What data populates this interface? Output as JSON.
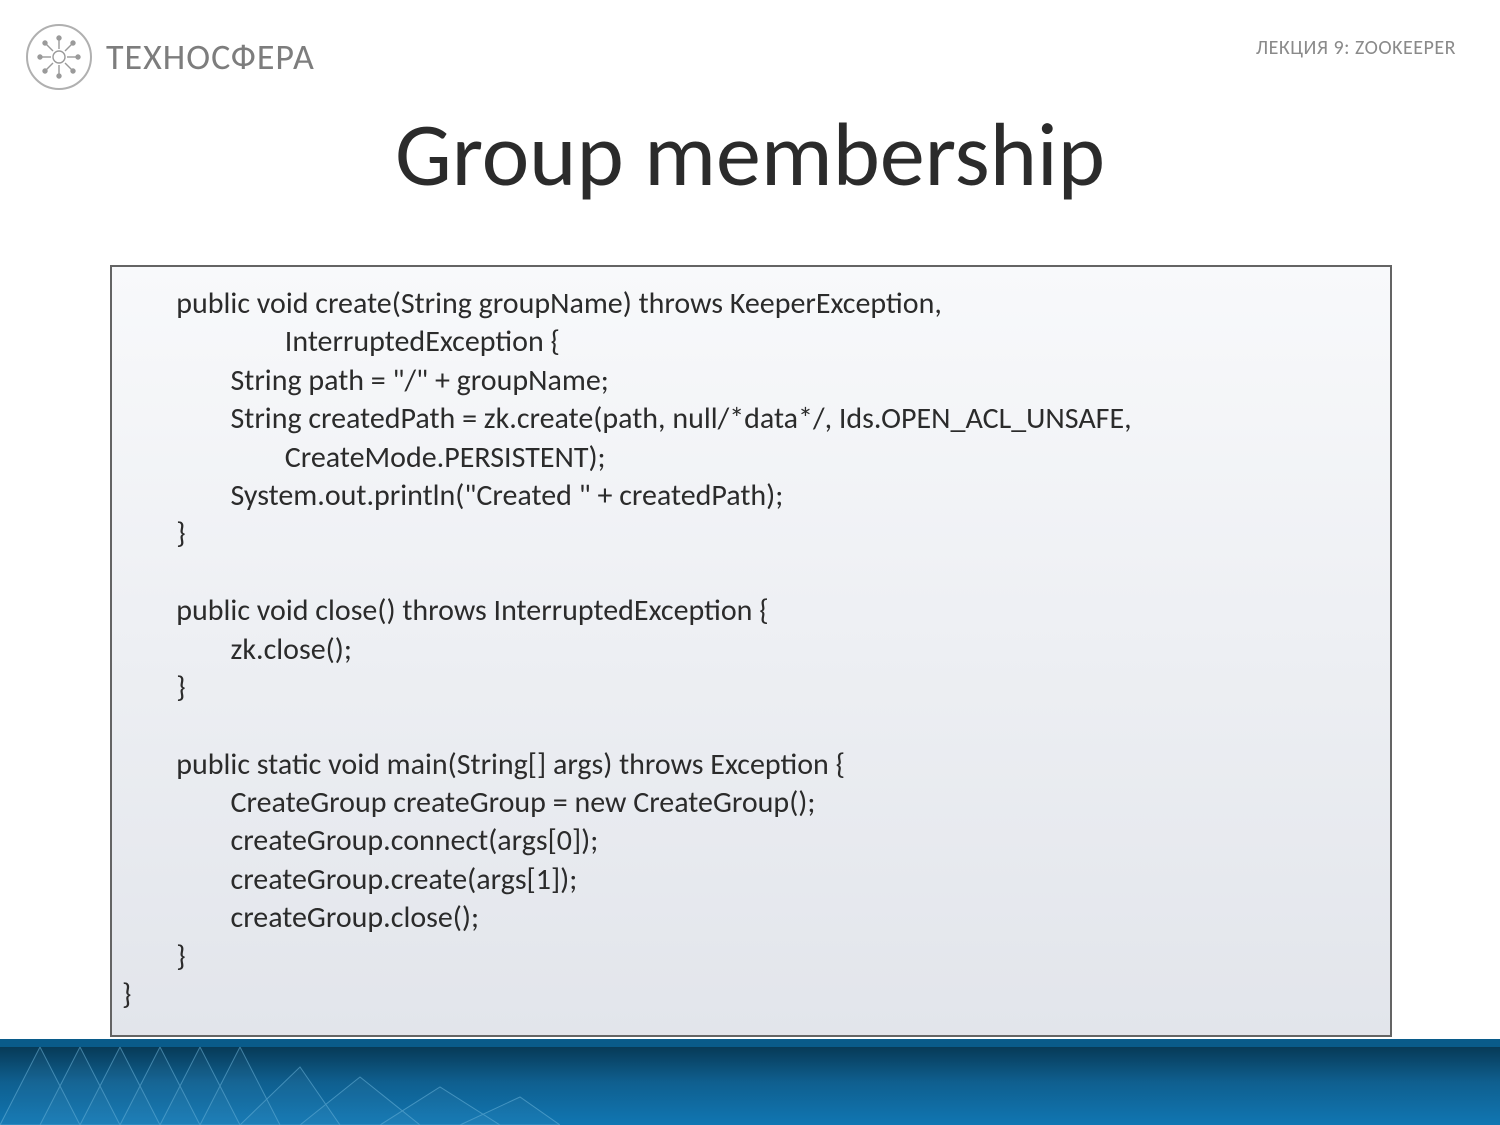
{
  "header": {
    "brand": "ТЕХНОСФЕРА",
    "lecture": "ЛЕКЦИЯ 9: ZOOKEEPER"
  },
  "title": "Group membership",
  "code_lines": [
    "        public void create(String groupName) throws KeeperException,",
    "                        InterruptedException {",
    "                String path = \"/\" + groupName;",
    "                String createdPath = zk.create(path, null/*data*/, Ids.OPEN_ACL_UNSAFE,",
    "                        CreateMode.PERSISTENT);",
    "                System.out.println(\"Created \" + createdPath);",
    "        }",
    "",
    "        public void close() throws InterruptedException {",
    "                zk.close();",
    "        }",
    "",
    "        public static void main(String[] args) throws Exception {",
    "                CreateGroup createGroup = new CreateGroup();",
    "                createGroup.connect(args[0]);",
    "                createGroup.create(args[1]);",
    "                createGroup.close();",
    "        }",
    "}"
  ]
}
